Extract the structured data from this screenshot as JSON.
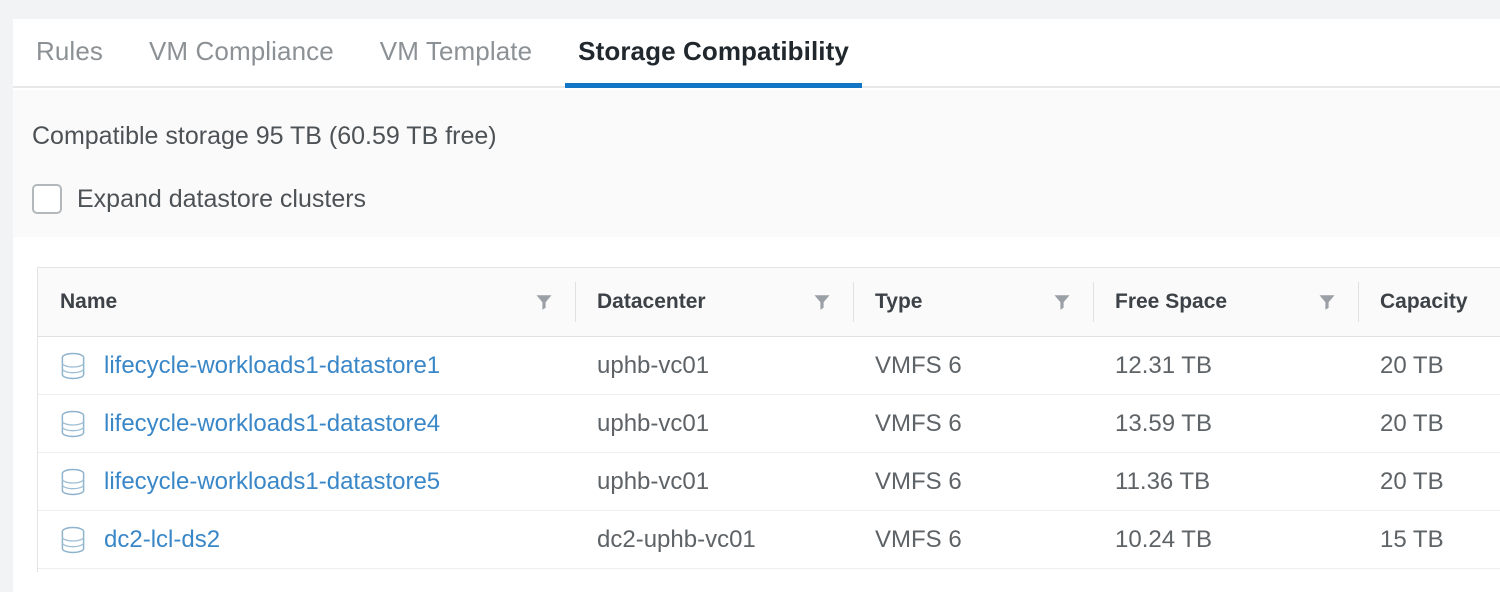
{
  "accent_color": "#1376c4",
  "link_color": "#3a87c8",
  "tabs": [
    {
      "label": "Rules",
      "active": false
    },
    {
      "label": "VM Compliance",
      "active": false
    },
    {
      "label": "VM Template",
      "active": false
    },
    {
      "label": "Storage Compatibility",
      "active": true
    }
  ],
  "summary": {
    "text": "Compatible storage 95 TB (60.59 TB free)"
  },
  "expand_clusters": {
    "label": "Expand datastore clusters",
    "checked": false
  },
  "table": {
    "columns": [
      {
        "label": "Name",
        "filterable": true
      },
      {
        "label": "Datacenter",
        "filterable": true
      },
      {
        "label": "Type",
        "filterable": true
      },
      {
        "label": "Free Space",
        "filterable": true
      },
      {
        "label": "Capacity",
        "filterable": false
      }
    ],
    "rows": [
      {
        "icon": "datastore-icon",
        "name": "lifecycle-workloads1-datastore1",
        "datacenter": "uphb-vc01",
        "type": "VMFS 6",
        "free_space": "12.31 TB",
        "capacity": "20 TB"
      },
      {
        "icon": "datastore-icon",
        "name": "lifecycle-workloads1-datastore4",
        "datacenter": "uphb-vc01",
        "type": "VMFS 6",
        "free_space": "13.59 TB",
        "capacity": "20 TB"
      },
      {
        "icon": "datastore-icon",
        "name": "lifecycle-workloads1-datastore5",
        "datacenter": "uphb-vc01",
        "type": "VMFS 6",
        "free_space": "11.36 TB",
        "capacity": "20 TB"
      },
      {
        "icon": "datastore-icon",
        "name": "dc2-lcl-ds2",
        "datacenter": "dc2-uphb-vc01",
        "type": "VMFS 6",
        "free_space": "10.24 TB",
        "capacity": "15 TB"
      }
    ]
  }
}
